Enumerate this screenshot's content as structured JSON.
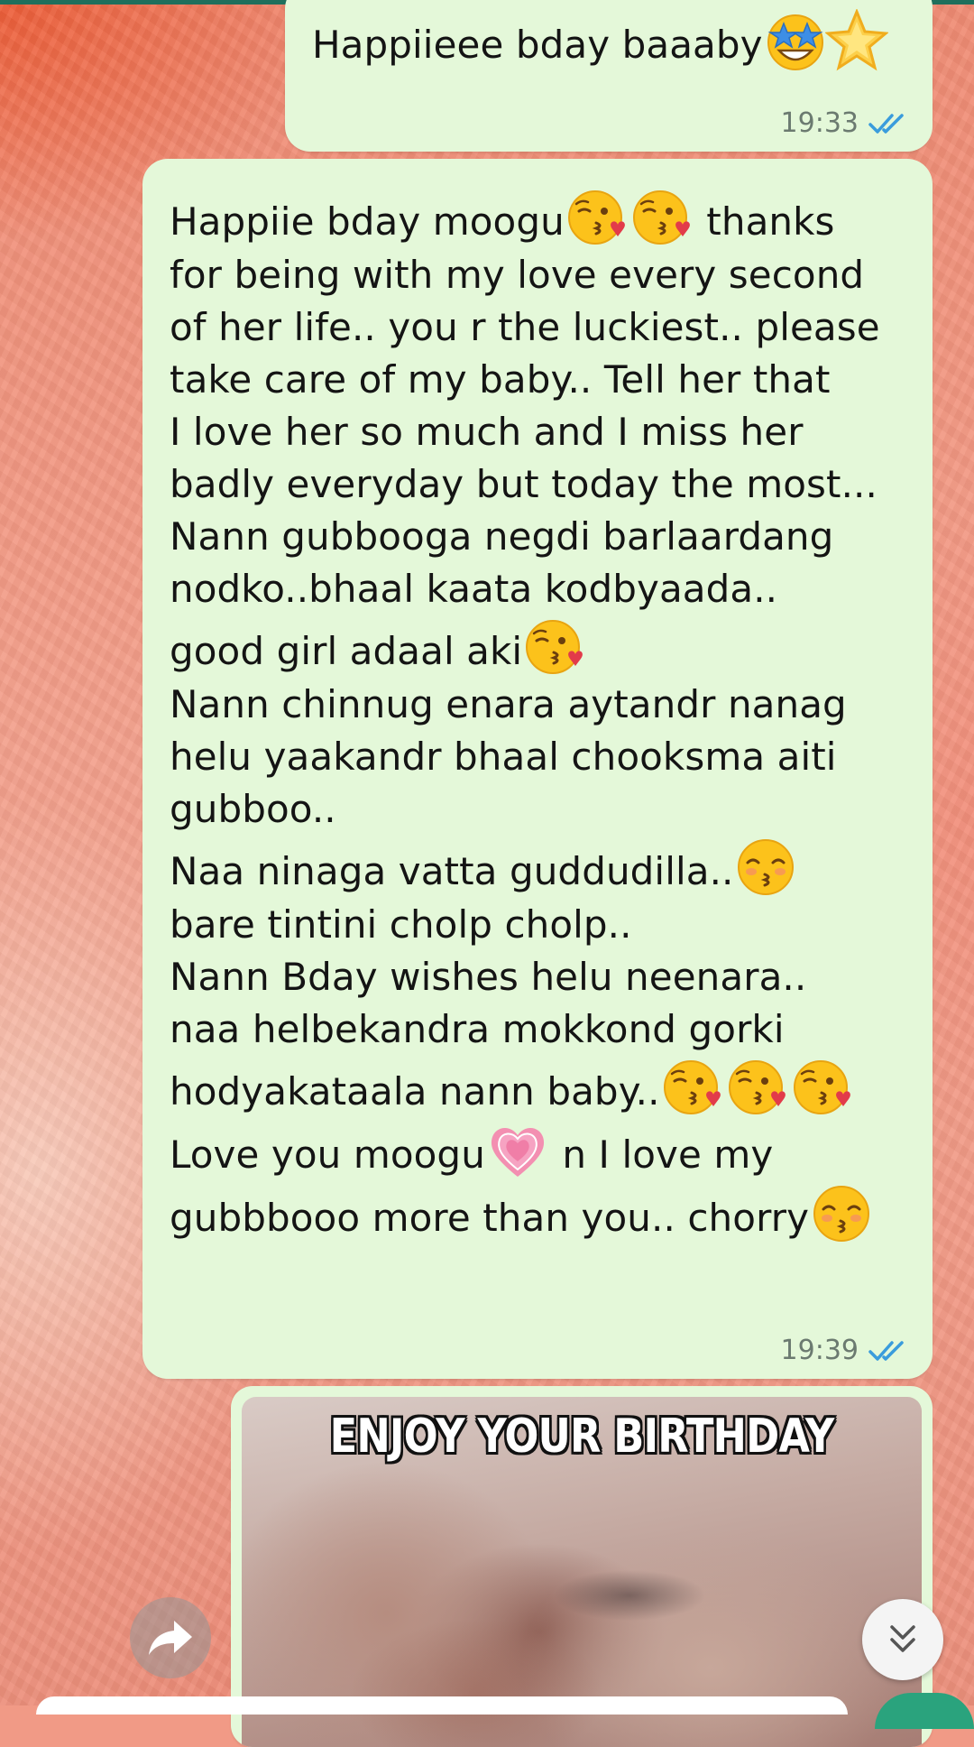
{
  "messages": [
    {
      "id": "m1",
      "type": "text",
      "text_before": "Happiieee bday baaaby",
      "emojis": [
        "star-struck-emoji",
        "star-emoji"
      ],
      "time": "19:33",
      "status": "read"
    },
    {
      "id": "m2",
      "type": "text",
      "lines": [
        {
          "text": "Happiie bday moogu",
          "emoji_after": [
            "kiss-emoji",
            "kiss-emoji"
          ],
          "tail": " thanks"
        },
        {
          "text": "for being with my love every second"
        },
        {
          "text": "of her life.. you r the luckiest.. please"
        },
        {
          "text": "take care of my baby.. Tell her that"
        },
        {
          "text": "I love her so much and I miss her"
        },
        {
          "text": "badly everyday but today the most..."
        },
        {
          "text": "Nann gubbooga negdi barlaardang"
        },
        {
          "text": "nodko..bhaal kaata kodbyaada.."
        },
        {
          "text": "good girl adaal aki",
          "emoji_after": [
            "kiss-emoji"
          ]
        },
        {
          "text": "Nann chinnug enara aytandr nanag"
        },
        {
          "text": "helu yaakandr bhaal chooksma aiti"
        },
        {
          "text": "gubboo.."
        },
        {
          "text": "Naa ninaga vatta guddudilla..",
          "emoji_after": [
            "kissing-closed-eyes-emoji"
          ]
        },
        {
          "text": "bare tintini cholp cholp.."
        },
        {
          "text": "Nann Bday wishes helu neenara.."
        },
        {
          "text": "naa helbekandra mokkond gorki"
        },
        {
          "text": "hodyakataala nann baby..",
          "emoji_after": [
            "kiss-emoji",
            "kiss-emoji",
            "kiss-emoji"
          ]
        },
        {
          "text": "Love you moogu",
          "emoji_after": [
            "growing-heart-emoji"
          ],
          "tail": " n I love my"
        },
        {
          "text": "gubbbooo more than you.. chorry",
          "emoji_after": [
            "kissing-closed-eyes-emoji"
          ]
        }
      ],
      "time": "19:39",
      "status": "read"
    },
    {
      "id": "m3",
      "type": "image",
      "caption": "ENJOY YOUR BIRTHDAY"
    }
  ],
  "controls": {
    "forward_icon": "forward-arrow-icon",
    "scroll_icon": "double-chevron-down-icon"
  },
  "colors": {
    "bubble": "#e4f8d9",
    "read_tick": "#3a9cdc",
    "header": "#1f6f5c",
    "accent": "#2aa37d"
  }
}
